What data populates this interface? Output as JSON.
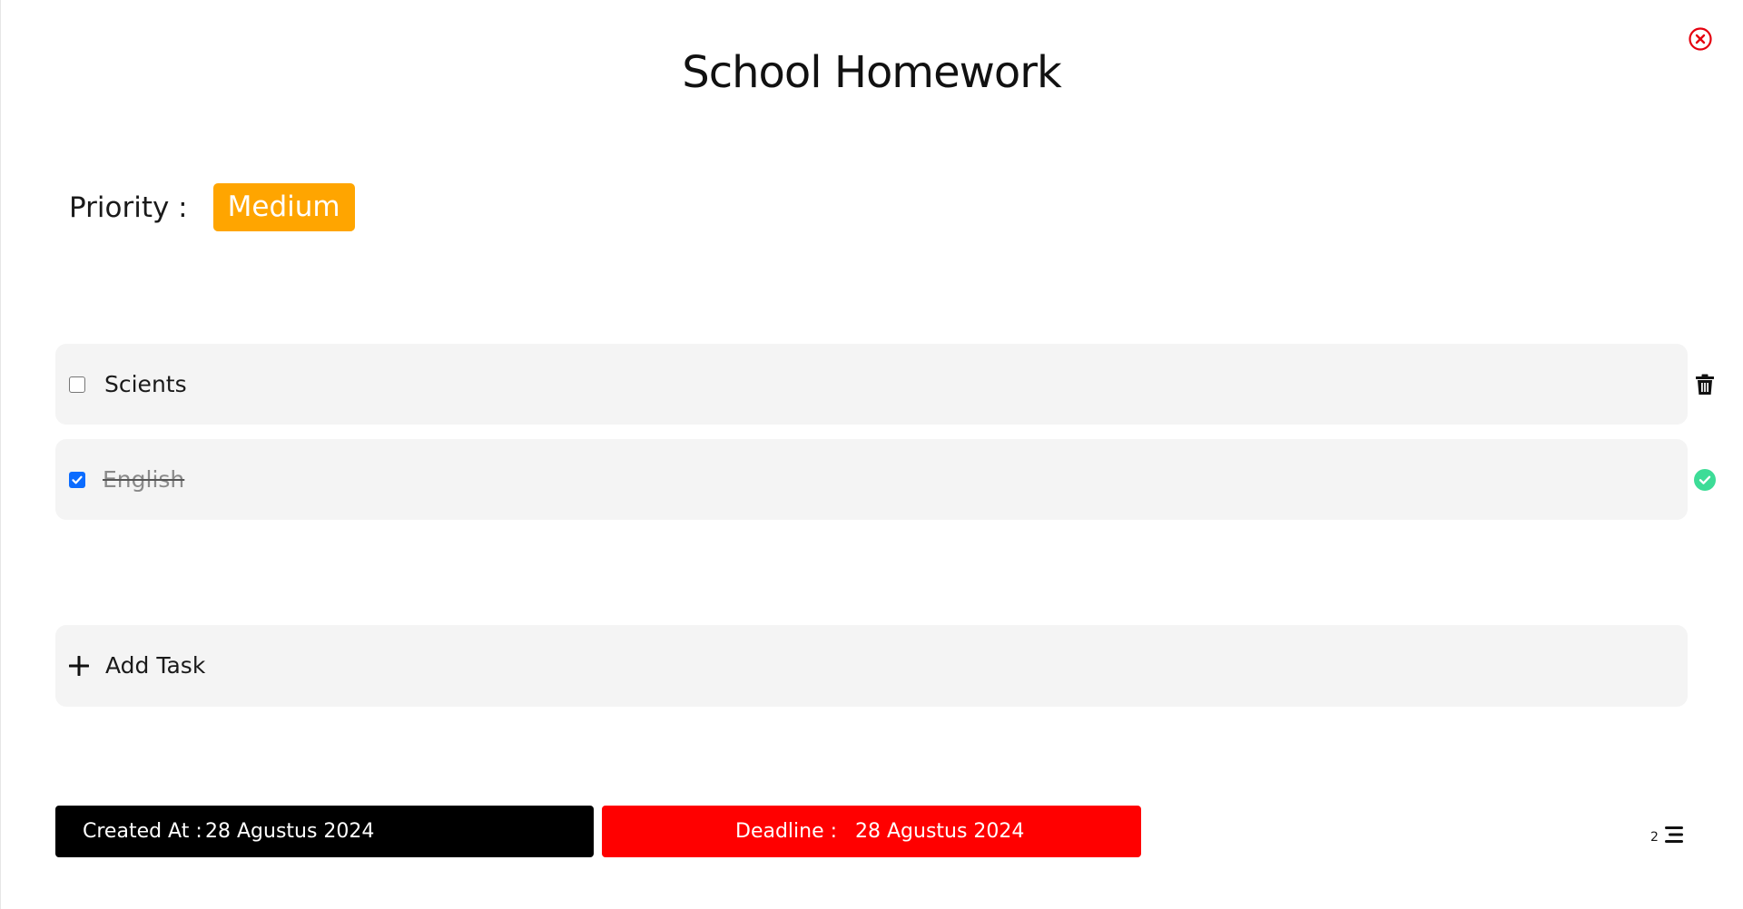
{
  "modal": {
    "title": "School Homework",
    "close_icon": "close-circle-icon"
  },
  "priority": {
    "label": "Priority :",
    "value": "Medium",
    "color": "#ffa500"
  },
  "tasks": [
    {
      "label": "Scients",
      "completed": false,
      "action_icon": "trash-icon"
    },
    {
      "label": "English",
      "completed": true,
      "action_icon": "check-circle-icon",
      "action_color": "#3ddc97"
    }
  ],
  "add_task": {
    "label": "Add Task",
    "icon": "plus-icon"
  },
  "footer": {
    "created_label": "Created At :",
    "created_value": "28 Agustus 2024",
    "deadline_label": "Deadline :",
    "deadline_value": "28 Agustus 2024",
    "deadline_color": "#ff0000",
    "task_count": "2",
    "list_icon": "list-icon"
  }
}
